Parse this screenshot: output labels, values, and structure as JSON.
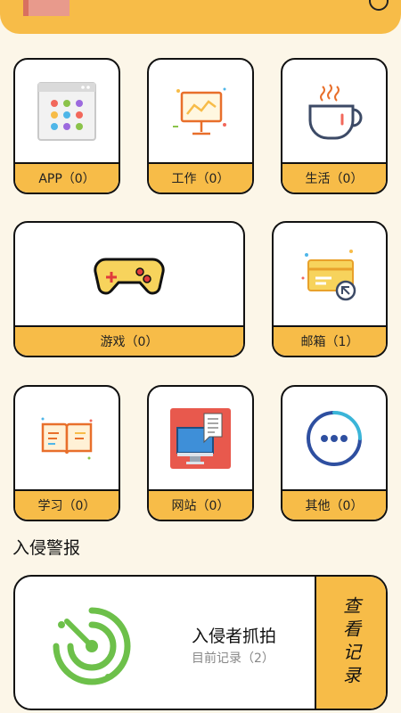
{
  "categories": [
    {
      "id": "app",
      "label": "APP（0）",
      "icon": "app-grid-icon"
    },
    {
      "id": "work",
      "label": "工作（0）",
      "icon": "presentation-board-icon"
    },
    {
      "id": "life",
      "label": "生活（0）",
      "icon": "coffee-cup-icon"
    },
    {
      "id": "game",
      "label": "游戏（0）",
      "icon": "gamepad-icon"
    },
    {
      "id": "mail",
      "label": "邮箱（1）",
      "icon": "mail-card-icon"
    },
    {
      "id": "study",
      "label": "学习（0）",
      "icon": "open-book-icon"
    },
    {
      "id": "website",
      "label": "网站（0）",
      "icon": "monitor-web-icon"
    },
    {
      "id": "other",
      "label": "其他（0）",
      "icon": "more-dots-icon"
    }
  ],
  "intrusion": {
    "section_title": "入侵警报",
    "title": "入侵者抓拍",
    "subtitle": "目前记录（2）",
    "view_button": "查看记录",
    "icon": "radar-icon"
  },
  "colors": {
    "accent": "#F7BC48",
    "background": "#FCF6E8",
    "radar_green": "#6DC04A"
  }
}
